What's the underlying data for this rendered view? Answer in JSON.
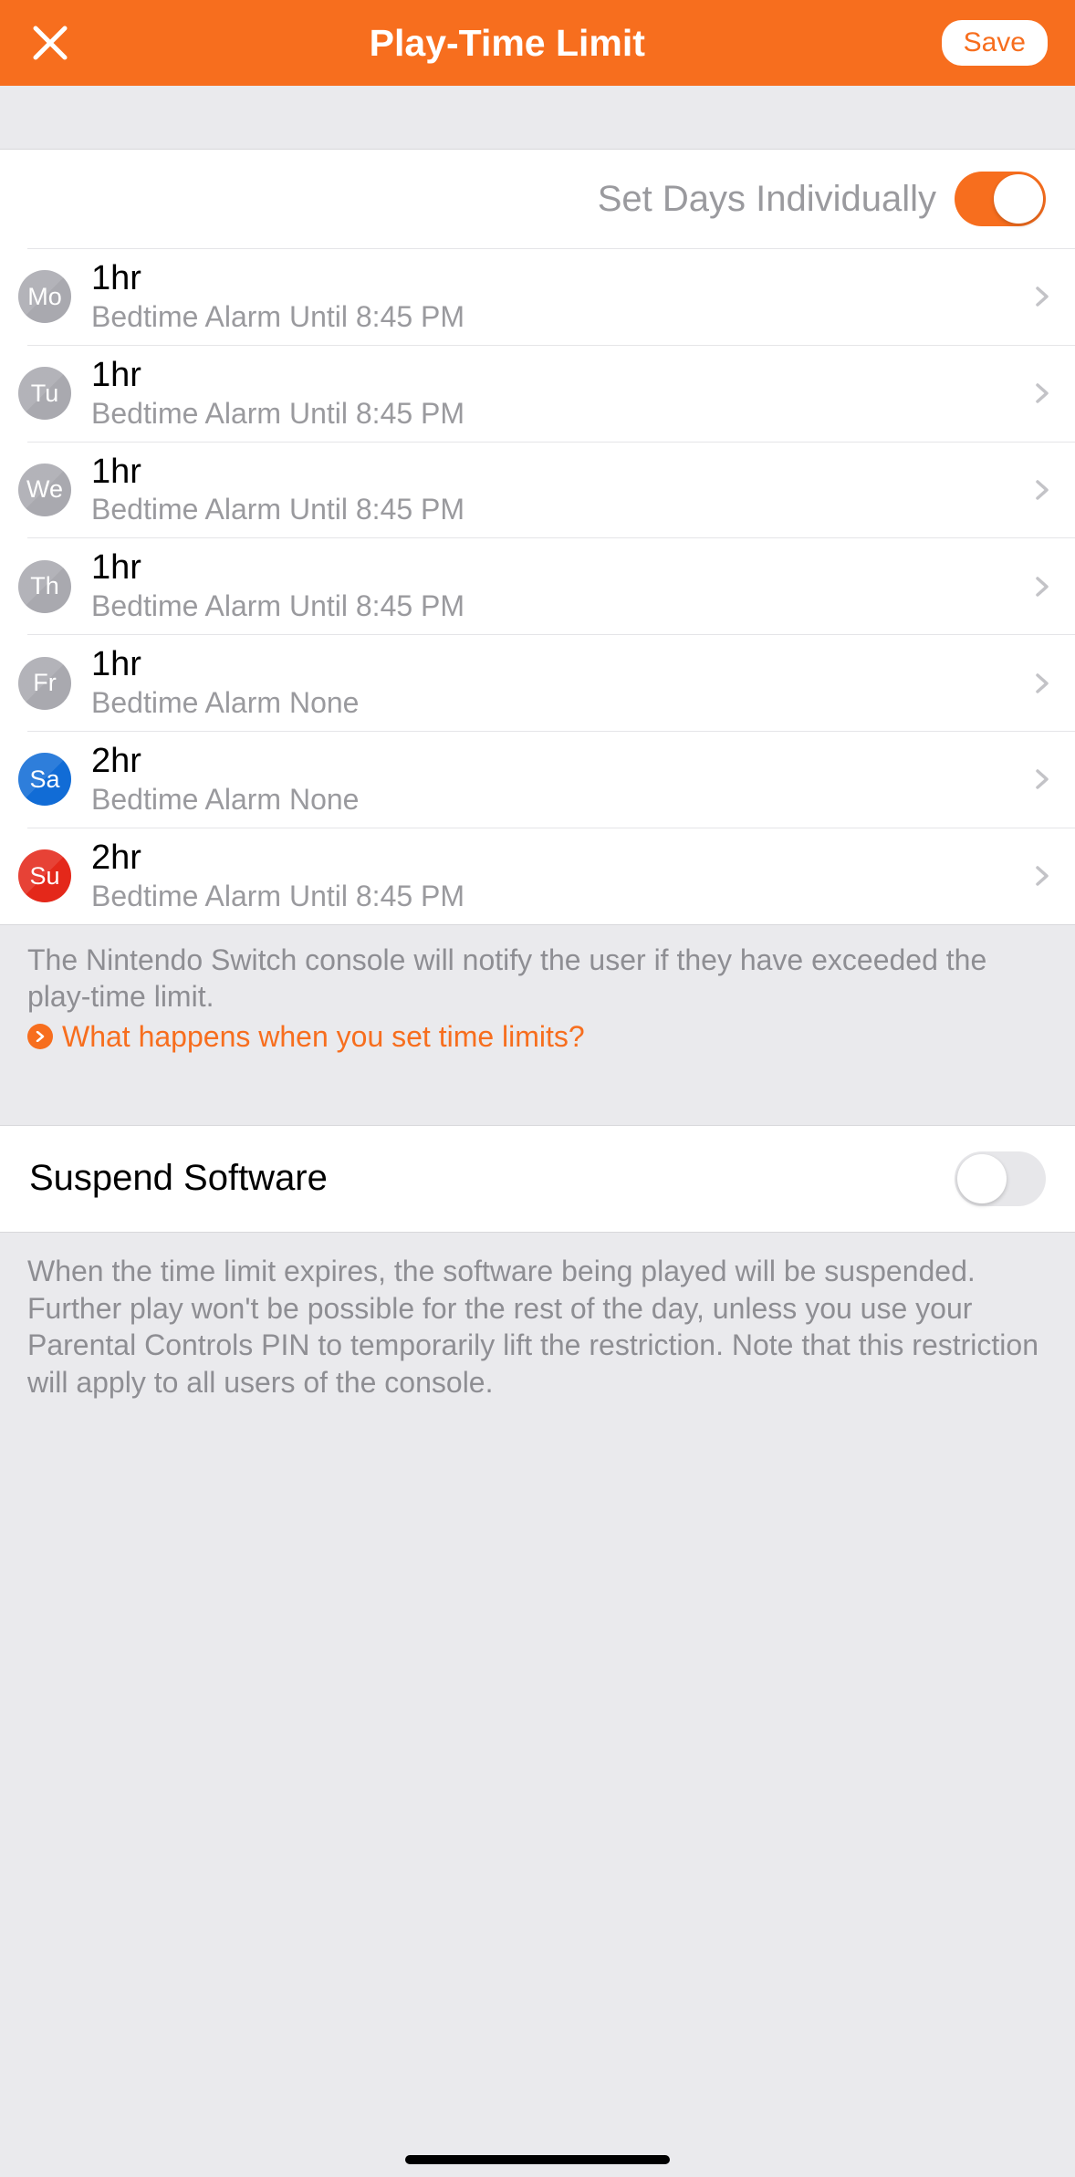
{
  "header": {
    "title": "Play-Time Limit",
    "save_label": "Save"
  },
  "toggle_individual": {
    "label": "Set Days Individually",
    "on": true
  },
  "days": [
    {
      "abbr": "Mo",
      "color": "gray",
      "value": "1hr",
      "sub": "Bedtime Alarm Until 8:45 PM"
    },
    {
      "abbr": "Tu",
      "color": "gray",
      "value": "1hr",
      "sub": "Bedtime Alarm Until 8:45 PM"
    },
    {
      "abbr": "We",
      "color": "gray",
      "value": "1hr",
      "sub": "Bedtime Alarm Until 8:45 PM"
    },
    {
      "abbr": "Th",
      "color": "gray",
      "value": "1hr",
      "sub": "Bedtime Alarm Until 8:45 PM"
    },
    {
      "abbr": "Fr",
      "color": "gray",
      "value": "1hr",
      "sub": "Bedtime Alarm None"
    },
    {
      "abbr": "Sa",
      "color": "blue",
      "value": "2hr",
      "sub": "Bedtime Alarm None"
    },
    {
      "abbr": "Su",
      "color": "red",
      "value": "2hr",
      "sub": "Bedtime Alarm Until 8:45 PM"
    }
  ],
  "info": {
    "desc": "The Nintendo Switch console will notify the user if they have exceeded the play-time limit.",
    "link": "What happens when you set time limits?"
  },
  "suspend": {
    "label": "Suspend Software",
    "on": false,
    "desc": "When the time limit expires, the software being played will be suspended. Further play won't be possible for the rest of the day, unless you use your Parental Controls PIN to temporarily lift the restriction. Note that this restriction will apply to all users of the console."
  }
}
